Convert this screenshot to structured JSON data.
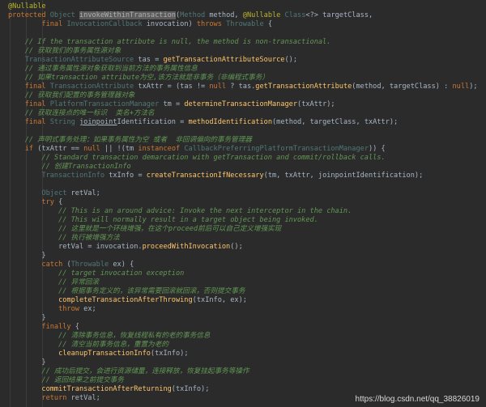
{
  "code_lines": [
    [
      {
        "t": "@Nullable",
        "c": "annotation"
      }
    ],
    [
      {
        "t": "protected ",
        "c": "keyword"
      },
      {
        "t": "Object ",
        "c": "type"
      },
      {
        "t": "invokeWithinTransaction",
        "c": "method hl"
      },
      {
        "t": "(",
        "c": "plain"
      },
      {
        "t": "Method ",
        "c": "type"
      },
      {
        "t": "method, ",
        "c": "plain"
      },
      {
        "t": "@Nullable ",
        "c": "annotation"
      },
      {
        "t": "Class",
        "c": "type"
      },
      {
        "t": "<?> targetClass,",
        "c": "plain"
      }
    ],
    [
      {
        "t": "        final ",
        "c": "keyword"
      },
      {
        "t": "InvocationCallback ",
        "c": "type"
      },
      {
        "t": "invocation) ",
        "c": "plain"
      },
      {
        "t": "throws ",
        "c": "keyword"
      },
      {
        "t": "Throwable ",
        "c": "type"
      },
      {
        "t": "{",
        "c": "plain"
      }
    ],
    [
      {
        "t": "",
        "c": "plain"
      }
    ],
    [
      {
        "t": "    // If the transaction attribute is null, the method is non-transactional.",
        "c": "comment"
      }
    ],
    [
      {
        "t": "    // 获取我们的事务属性源对象",
        "c": "comment"
      }
    ],
    [
      {
        "t": "    TransactionAttributeSource ",
        "c": "type"
      },
      {
        "t": "tas = ",
        "c": "plain"
      },
      {
        "t": "getTransactionAttributeSource",
        "c": "method"
      },
      {
        "t": "();",
        "c": "plain"
      }
    ],
    [
      {
        "t": "    // 通过事务属性源对象获取到当前方法的事务属性信息",
        "c": "comment"
      }
    ],
    [
      {
        "t": "    // 如果transaction attribute为空,该方法就是非事务（非编程式事务）",
        "c": "comment"
      }
    ],
    [
      {
        "t": "    final ",
        "c": "keyword"
      },
      {
        "t": "TransactionAttribute ",
        "c": "type"
      },
      {
        "t": "txAttr = (tas != ",
        "c": "plain"
      },
      {
        "t": "null ",
        "c": "keyword"
      },
      {
        "t": "? tas.",
        "c": "plain"
      },
      {
        "t": "getTransactionAttribute",
        "c": "method"
      },
      {
        "t": "(method, targetClass) : ",
        "c": "plain"
      },
      {
        "t": "null",
        "c": "keyword"
      },
      {
        "t": ");",
        "c": "plain"
      }
    ],
    [
      {
        "t": "    // 获取我们配置的事务管理器对象",
        "c": "comment"
      }
    ],
    [
      {
        "t": "    final ",
        "c": "keyword"
      },
      {
        "t": "PlatformTransactionManager ",
        "c": "type"
      },
      {
        "t": "tm = ",
        "c": "plain"
      },
      {
        "t": "determineTransactionManager",
        "c": "method"
      },
      {
        "t": "(txAttr);",
        "c": "plain"
      }
    ],
    [
      {
        "t": "    // 获取连接点的唯一标识  类名+方法名",
        "c": "comment"
      }
    ],
    [
      {
        "t": "    final ",
        "c": "keyword"
      },
      {
        "t": "String ",
        "c": "type"
      },
      {
        "t": "joinpoint",
        "c": "plain under"
      },
      {
        "t": "Identification = ",
        "c": "plain"
      },
      {
        "t": "methodIdentification",
        "c": "method"
      },
      {
        "t": "(method, targetClass, txAttr);",
        "c": "plain"
      }
    ],
    [
      {
        "t": "",
        "c": "plain"
      }
    ],
    [
      {
        "t": "    // 声明式事务处理：如果事务属性为空 或者  非回调偏向的事务管理器",
        "c": "comment"
      }
    ],
    [
      {
        "t": "    if ",
        "c": "keyword"
      },
      {
        "t": "(txAttr == ",
        "c": "plain"
      },
      {
        "t": "null ",
        "c": "keyword"
      },
      {
        "t": "|| !(tm ",
        "c": "plain"
      },
      {
        "t": "instanceof ",
        "c": "keyword"
      },
      {
        "t": "CallbackPreferringPlatformTransactionManager",
        "c": "type"
      },
      {
        "t": ")) {",
        "c": "plain"
      }
    ],
    [
      {
        "t": "        // Standard transaction demarcation with getTransaction and commit/rollback calls.",
        "c": "comment"
      }
    ],
    [
      {
        "t": "        // 创建TransactionInfo",
        "c": "comment"
      }
    ],
    [
      {
        "t": "        TransactionInfo ",
        "c": "type"
      },
      {
        "t": "txInfo = ",
        "c": "plain"
      },
      {
        "t": "createTransactionIfNecessary",
        "c": "method"
      },
      {
        "t": "(tm, txAttr, joinpointIdentification);",
        "c": "plain"
      }
    ],
    [
      {
        "t": "",
        "c": "plain"
      }
    ],
    [
      {
        "t": "        Object ",
        "c": "type"
      },
      {
        "t": "retVal;",
        "c": "plain"
      }
    ],
    [
      {
        "t": "        try ",
        "c": "keyword"
      },
      {
        "t": "{",
        "c": "plain"
      }
    ],
    [
      {
        "t": "            // This is an around advice: Invoke the next interceptor in the chain.",
        "c": "comment"
      }
    ],
    [
      {
        "t": "            // This will normally result in a target object being invoked.",
        "c": "comment"
      }
    ],
    [
      {
        "t": "            // 这里就是一个环绕增强，在这个proceed前后可以自己定义增强实现",
        "c": "comment"
      }
    ],
    [
      {
        "t": "            // 执行被增强方法",
        "c": "comment"
      }
    ],
    [
      {
        "t": "            retVal = invocation.",
        "c": "plain"
      },
      {
        "t": "proceedWithInvocation",
        "c": "method"
      },
      {
        "t": "();",
        "c": "plain"
      }
    ],
    [
      {
        "t": "        }",
        "c": "plain"
      }
    ],
    [
      {
        "t": "        catch ",
        "c": "keyword"
      },
      {
        "t": "(",
        "c": "plain"
      },
      {
        "t": "Throwable ",
        "c": "type"
      },
      {
        "t": "ex) {",
        "c": "plain"
      }
    ],
    [
      {
        "t": "            // target invocation exception",
        "c": "comment"
      }
    ],
    [
      {
        "t": "            // 异常回滚",
        "c": "comment"
      }
    ],
    [
      {
        "t": "            // 根据事务定义的，该异常需要回滚就回滚，否则提交事务",
        "c": "comment"
      }
    ],
    [
      {
        "t": "            ",
        "c": "plain"
      },
      {
        "t": "completeTransactionAfterThrowing",
        "c": "method"
      },
      {
        "t": "(txInfo, ex);",
        "c": "plain"
      }
    ],
    [
      {
        "t": "            throw ",
        "c": "keyword"
      },
      {
        "t": "ex;",
        "c": "plain"
      }
    ],
    [
      {
        "t": "        }",
        "c": "plain"
      }
    ],
    [
      {
        "t": "        finally ",
        "c": "keyword"
      },
      {
        "t": "{",
        "c": "plain"
      }
    ],
    [
      {
        "t": "            // 清除事务信息，恢复线程私有的老的事务信息",
        "c": "comment"
      }
    ],
    [
      {
        "t": "            // 清空当前事务信息，重置为老的",
        "c": "comment"
      }
    ],
    [
      {
        "t": "            ",
        "c": "plain"
      },
      {
        "t": "cleanupTransactionInfo",
        "c": "method"
      },
      {
        "t": "(txInfo);",
        "c": "plain"
      }
    ],
    [
      {
        "t": "        }",
        "c": "plain"
      }
    ],
    [
      {
        "t": "        // 成功后提交，会进行资源储量，连接释放，恢复挂起事务等操作",
        "c": "comment"
      }
    ],
    [
      {
        "t": "        // 返回结果之前提交事务",
        "c": "comment"
      }
    ],
    [
      {
        "t": "        ",
        "c": "plain"
      },
      {
        "t": "commitTransactionAfterReturning",
        "c": "method"
      },
      {
        "t": "(txInfo);",
        "c": "plain"
      }
    ],
    [
      {
        "t": "        return ",
        "c": "keyword"
      },
      {
        "t": "retVal;",
        "c": "plain"
      }
    ]
  ],
  "watermark": "https://blog.csdn.net/qq_38826019",
  "colors": {
    "background": "#2b2b2b",
    "text": "#a9b7c6",
    "keyword": "#cc7832",
    "comment": "#629755",
    "method": "#ffc66d",
    "type": "#507874",
    "annotation": "#bbb529"
  }
}
